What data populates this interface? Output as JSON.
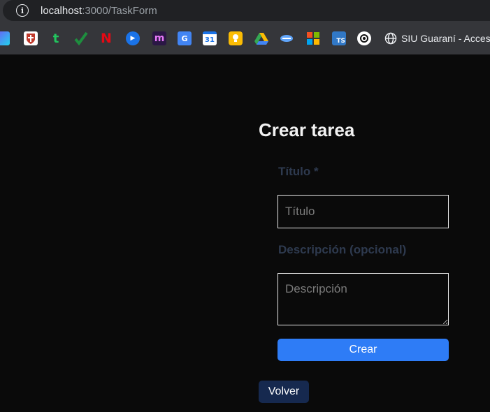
{
  "browser": {
    "url_host": "localhost",
    "url_path": ":3000/TaskForm",
    "bookmarks": [
      {
        "icon": "copilot-icon",
        "color": "#6b5cf6"
      },
      {
        "icon": "university-shield-icon",
        "color": "#c0392b"
      },
      {
        "icon": "t-icon",
        "color": "#22c55e"
      },
      {
        "icon": "checkmark-icon",
        "color": "#1e8e3e"
      },
      {
        "icon": "netflix-icon",
        "color": "#e50914"
      },
      {
        "icon": "play-icon",
        "color": "#1a73e8"
      },
      {
        "icon": "m-icon",
        "color": "#3b1f5e"
      },
      {
        "icon": "google-translate-icon",
        "color": "#4285f4"
      },
      {
        "icon": "google-calendar-icon",
        "color": "#1a73e8"
      },
      {
        "icon": "google-keep-icon",
        "color": "#fbbc04"
      },
      {
        "icon": "google-drive-icon",
        "color": "#34a853"
      },
      {
        "icon": "handshake-icon",
        "color": "#3b82f6"
      },
      {
        "icon": "microsoft-icon",
        "color": "#f25022"
      },
      {
        "icon": "typescript-icon",
        "color": "#3178c6"
      },
      {
        "icon": "openai-icon",
        "color": "#ffffff"
      },
      {
        "icon": "globe-icon",
        "color": "#e8eaed"
      }
    ],
    "bookmark_siu_label": "SIU Guaraní - Acceso"
  },
  "form": {
    "title": "Crear tarea",
    "titulo_label": "Título *",
    "titulo_placeholder": "Título",
    "descripcion_label": "Descripción (opcional)",
    "descripcion_placeholder": "Descripción",
    "submit_label": "Crear",
    "back_label": "Volver"
  },
  "colors": {
    "background": "#0a0a0a",
    "label": "#2e3a4f",
    "primary": "#2e7cf6",
    "secondary": "#16294f"
  }
}
